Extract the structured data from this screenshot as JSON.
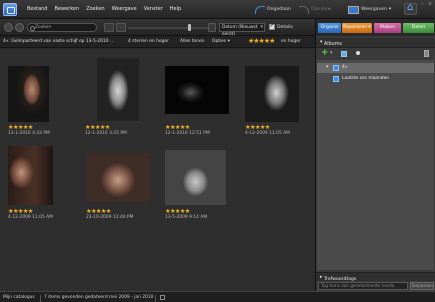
{
  "menu": {
    "items": [
      "Bestand",
      "Bewerken",
      "Zoeken",
      "Weergave",
      "Venster",
      "Help"
    ],
    "undo_label": "Ongedaan",
    "redo_label": "Opnieuw",
    "display_label": "Weergaven"
  },
  "toolbar": {
    "zoom_placeholder": "Zoeken",
    "sort_value": "Datum (Nieuwst eerst)",
    "details_label": "Details"
  },
  "filterbar": {
    "breadcrumb": "4»: Geïmporteerd van vaste schijf op 13-5-2010 …",
    "count": "4 sterren  en hoger",
    "show_all": "Alles tonen",
    "options": "Opties",
    "rating_suffix": "en hoger"
  },
  "photos": [
    {
      "stars": "★★★★★",
      "date": "13-1-2010 4:43 PM"
    },
    {
      "stars": "★★★★★",
      "date": "12-1-2010 3:25 PM"
    },
    {
      "stars": "★★★★★",
      "date": "12-1-2010 12:51 PM"
    },
    {
      "stars": "★★★★★",
      "date": "4-12-2009 11:05 AM"
    },
    {
      "stars": "★★★★★",
      "date": "4-12-2009 11:05 AM"
    },
    {
      "stars": "★★★★★",
      "date": "23-10-2009 12:40 PM"
    },
    {
      "stars": "★★★★★",
      "date": "13-5-2009 9:14 AM"
    }
  ],
  "panel": {
    "tabs": [
      "Organis",
      "Repareren",
      "Maken",
      "Delen"
    ],
    "albums_title": "Albums",
    "albums": [
      {
        "label": "4»"
      },
      {
        "label": "Laatste zes maanden"
      }
    ],
    "tags_title": "Trefwoordtags",
    "tags_placeholder": "Tag toms aan geselecteerde media",
    "tags_apply": "Toepassen"
  },
  "status": {
    "catalog": "Mijn catalogus",
    "summary": "7 items gevonden gedateerd mei 2009 - jan 2010"
  },
  "colors": {
    "accent_blue": "#3a8ee6",
    "star_gold": "#f2b01e",
    "tab_organize": "#2a66b5",
    "tab_fix": "#c86a14",
    "tab_create": "#a83e7c",
    "tab_share": "#3b8a3a"
  }
}
